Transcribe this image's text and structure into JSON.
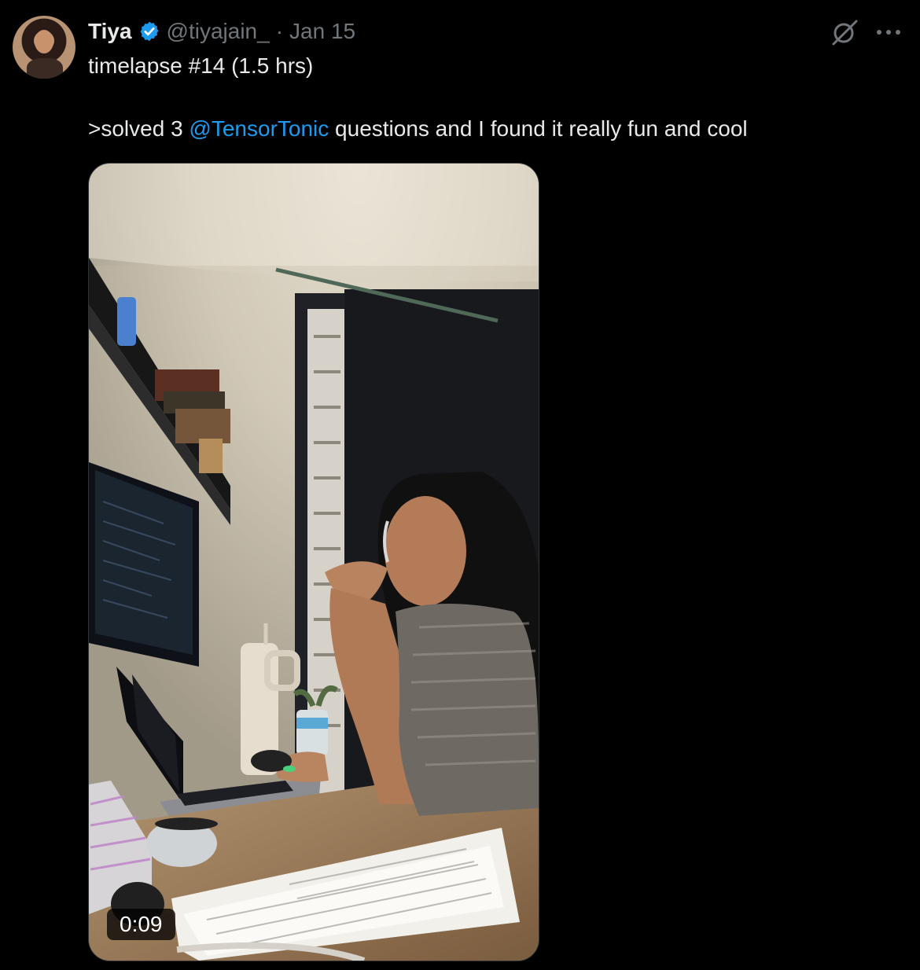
{
  "tweet": {
    "author_name": "Tiya",
    "handle": "@tiyajain_",
    "separator": "·",
    "date": "Jan 15",
    "line1": "timelapse #14 (1.5 hrs)",
    "line2_prefix": ">solved 3 ",
    "mention": "@TensorTonic",
    "line2_suffix": " questions and I found it really fun and cool"
  },
  "media": {
    "duration": "0:09"
  },
  "icons": {
    "verified": "verified-badge-icon",
    "grok": "grok-icon",
    "more": "more-icon"
  },
  "colors": {
    "background": "#000000",
    "text": "#e7e9ea",
    "muted": "#71767b",
    "accent": "#1d9bf0"
  }
}
